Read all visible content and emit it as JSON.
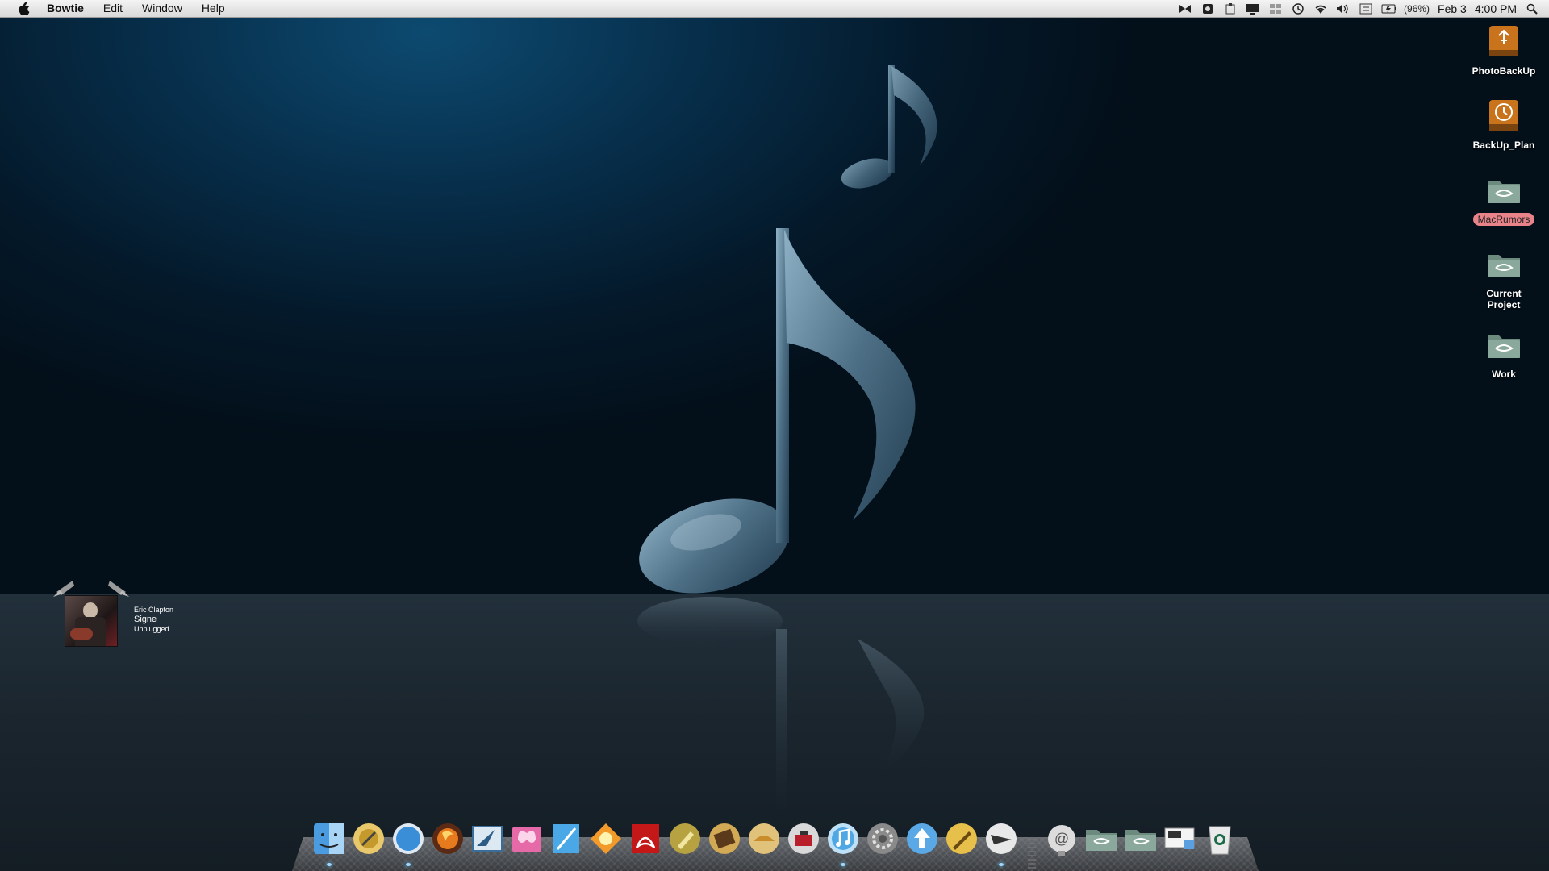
{
  "menubar": {
    "app_name": "Bowtie",
    "menus": [
      "Edit",
      "Window",
      "Help"
    ],
    "battery_percent": "(96%)",
    "date": "Feb 3",
    "time": "4:00 PM"
  },
  "desktop_icons": [
    {
      "label": "PhotoBackUp",
      "icon": "usb-drive-icon",
      "selected": false
    },
    {
      "label": "BackUp_Plan",
      "icon": "time-machine-drive-icon",
      "selected": false
    },
    {
      "label": "MacRumors",
      "icon": "folder-icon",
      "selected": true
    },
    {
      "label": "Current Project",
      "icon": "folder-icon",
      "selected": false
    },
    {
      "label": "Work",
      "icon": "folder-icon",
      "selected": false
    }
  ],
  "bowtie_widget": {
    "artist": "Eric Clapton",
    "song": "Signe",
    "album": "Unplugged"
  },
  "dock": {
    "apps": [
      "finder-icon",
      "app-store-icon",
      "safari-icon",
      "firefox-icon",
      "mail-icon",
      "butterfly-app-icon",
      "pages-icon",
      "photos-icon",
      "acrobat-icon",
      "script-icon",
      "book-icon",
      "notes-icon",
      "toolbox-icon",
      "itunes-icon",
      "system-preferences-icon",
      "upload-icon",
      "pen-icon",
      "scissors-icon"
    ],
    "right_items": [
      "address-icon",
      "downloads-folder-icon",
      "applications-folder-icon",
      "screen-icon",
      "trash-icon"
    ]
  },
  "colors": {
    "menubar_bg": "#e4e4e4",
    "selected_label": "#e8838a",
    "wallpaper_glow": "#0d4a70"
  }
}
